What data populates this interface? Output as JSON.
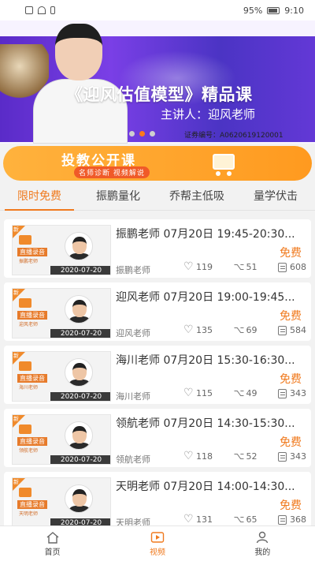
{
  "status_bar": {
    "battery": "95%",
    "time": "9:10"
  },
  "hero": {
    "title": "《迎风估值模型》精品课",
    "subtitle": "主讲人：迎风老师",
    "certificate": "证券编号：A0620619120001",
    "banner_dots": 3,
    "active_dot": 1
  },
  "promo": {
    "title": "投教公开课",
    "subtitle": "名师诊断 视频解说"
  },
  "tabs": [
    {
      "label": "限时免费",
      "active": true
    },
    {
      "label": "振鹏量化",
      "active": false
    },
    {
      "label": "乔帮主低吸",
      "active": false
    },
    {
      "label": "量学伏击",
      "active": false
    }
  ],
  "courses": [
    {
      "title": "振鹏老师 07月20日 19:45-20:30...",
      "teacher": "振鹏老师",
      "price": "免费",
      "likes": "119",
      "shares": "51",
      "views": "608",
      "date": "2020-07-20",
      "thumb_label": "直播录音",
      "thumb_name": "振鹏老师"
    },
    {
      "title": "迎风老师 07月20日 19:00-19:45...",
      "teacher": "迎风老师",
      "price": "免费",
      "likes": "135",
      "shares": "69",
      "views": "584",
      "date": "2020-07-20",
      "thumb_label": "直播录音",
      "thumb_name": "迎风老师"
    },
    {
      "title": "海川老师 07月20日 15:30-16:30...",
      "teacher": "海川老师",
      "price": "免费",
      "likes": "115",
      "shares": "49",
      "views": "343",
      "date": "2020-07-20",
      "thumb_label": "直播录音",
      "thumb_name": "海川老师"
    },
    {
      "title": "领航老师 07月20日 14:30-15:30...",
      "teacher": "领航老师",
      "price": "免费",
      "likes": "118",
      "shares": "52",
      "views": "343",
      "date": "2020-07-20",
      "thumb_label": "直播录音",
      "thumb_name": "领航老师"
    },
    {
      "title": "天明老师 07月20日 14:00-14:30...",
      "teacher": "天明老师",
      "price": "免费",
      "likes": "131",
      "shares": "65",
      "views": "368",
      "date": "2020-07-20",
      "thumb_label": "直播录音",
      "thumb_name": "天明老师"
    }
  ],
  "nav": [
    {
      "label": "首页",
      "icon": "home-icon",
      "active": false
    },
    {
      "label": "视频",
      "icon": "video-icon",
      "active": true
    },
    {
      "label": "我的",
      "icon": "profile-icon",
      "active": false
    }
  ],
  "colors": {
    "accent": "#f07a1e",
    "banner": "#6338d6",
    "promo": "#ffa52b"
  }
}
